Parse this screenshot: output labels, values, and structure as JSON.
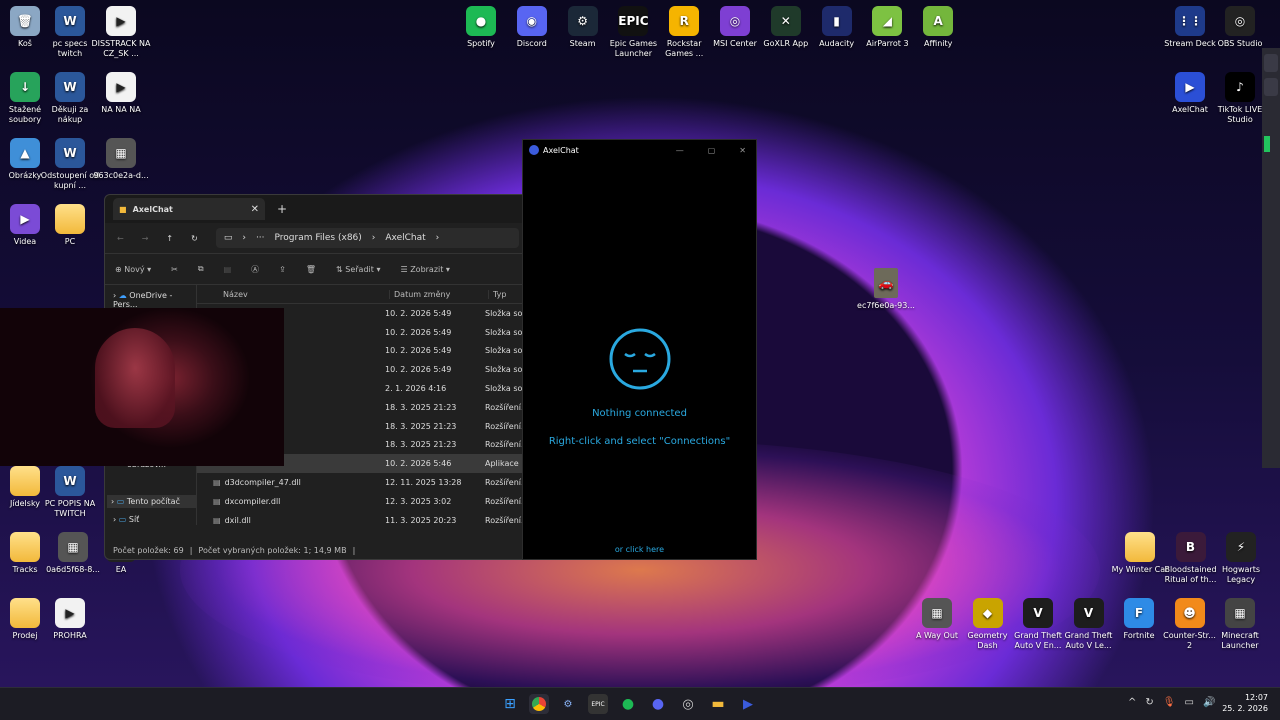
{
  "desktop_left": [
    {
      "label": "Koš",
      "type": "bin"
    },
    {
      "label": "pc specs twitch",
      "type": "word"
    },
    {
      "label": "DISSTRACK NA CZ_SK ...",
      "type": "video"
    },
    {
      "label": "Stažené soubory",
      "type": "dl"
    },
    {
      "label": "Děkuji za nákup",
      "type": "word"
    },
    {
      "label": "NA NA NA",
      "type": "video"
    },
    {
      "label": "Obrázky",
      "type": "pic"
    },
    {
      "label": "Odstoupení od kupní ...",
      "type": "word"
    },
    {
      "label": "963c0e2a-d...",
      "type": "img"
    },
    {
      "label": "Videa",
      "type": "vid"
    },
    {
      "label": "PC",
      "type": "folder"
    },
    {
      "label": "Jídelsky",
      "type": "folder"
    },
    {
      "label": "PC POPIS NA TWITCH",
      "type": "word"
    },
    {
      "label": "Tracks",
      "type": "folder"
    },
    {
      "label": "0a6d5f68-8...",
      "type": "img"
    },
    {
      "label": "EA",
      "type": "ea"
    },
    {
      "label": "Prodej",
      "type": "folder"
    },
    {
      "label": "PROHRA",
      "type": "video"
    }
  ],
  "desktop_top": [
    "Spotify",
    "Discord",
    "Steam",
    "Epic Games Launcher",
    "Rockstar Games ...",
    "MSI Center",
    "GoXLR App",
    "Audacity",
    "AirParrot 3",
    "Affinity"
  ],
  "desktop_right_top": [
    "Stream Deck",
    "OBS Studio",
    "AxelChat",
    "TikTok LIVE Studio"
  ],
  "desktop_mid": {
    "label": "ec7f6e0a-93..."
  },
  "desktop_right_bottom_row1": [
    "My Winter Car",
    "Bloodstained Ritual of th...",
    "Hogwarts Legacy"
  ],
  "desktop_right_bottom_row2": [
    "A Way Out",
    "Geometry Dash",
    "Grand Theft Auto V En...",
    "Grand Theft Auto V Le...",
    "Fortnite",
    "Counter-Str... 2",
    "Minecraft Launcher"
  ],
  "explorer": {
    "tab": "AxelChat",
    "breadcrumb": [
      "Program Files (x86)",
      "AxelChat"
    ],
    "toolbar": {
      "new": "Nový",
      "sort": "Seřadit",
      "view": "Zobrazit"
    },
    "nav": [
      "OneDrive - Pers...",
      "Snímky obrazov...",
      "Tento počítač",
      "Síť"
    ],
    "columns": {
      "name": "Název",
      "date": "Datum změny",
      "type": "Typ"
    },
    "rows": [
      {
        "name": "",
        "date": "10. 2. 2026 5:49",
        "type": "Složka so..."
      },
      {
        "name": "",
        "date": "10. 2. 2026 5:49",
        "type": "Složka so..."
      },
      {
        "name": "",
        "date": "10. 2. 2026 5:49",
        "type": "Složka so..."
      },
      {
        "name": "",
        "date": "10. 2. 2026 5:49",
        "type": "Složka so..."
      },
      {
        "name": "",
        "date": "2. 1. 2026 4:16",
        "type": "Složka so..."
      },
      {
        "name": "ll",
        "date": "18. 3. 2025 21:23",
        "type": "Rozšíření..."
      },
      {
        "name": "lll",
        "date": "18. 3. 2025 21:23",
        "type": "Rozšíření..."
      },
      {
        "name": "",
        "date": "18. 3. 2025 21:23",
        "type": "Rozšíření..."
      },
      {
        "name": "",
        "date": "10. 2. 2026 5:46",
        "type": "Aplikace"
      },
      {
        "name": "d3dcompiler_47.dll",
        "date": "12. 11. 2025 13:28",
        "type": "Rozšíření..."
      },
      {
        "name": "dxcompiler.dll",
        "date": "12. 3. 2025 3:02",
        "type": "Rozšíření..."
      },
      {
        "name": "dxil.dll",
        "date": "11. 3. 2025 20:23",
        "type": "Rozšíření..."
      }
    ],
    "status_count": "Počet položek: 69",
    "status_selected": "Počet vybraných položek: 1; 14,9 MB"
  },
  "axelchat": {
    "title": "AxelChat",
    "nothing": "Nothing connected",
    "hint": "Right-click and select \"Connections\"",
    "click": "or click here"
  },
  "clock": {
    "time": "12:07",
    "date": "25. 2. 2026"
  },
  "colors": {
    "accent": "#2aa9e0",
    "taskbar": "#1c1c24"
  }
}
